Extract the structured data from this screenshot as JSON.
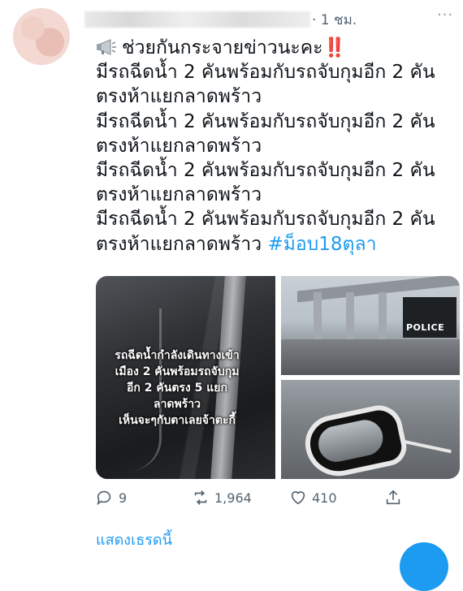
{
  "tweet": {
    "time": "· 1 ชม.",
    "more_label": "···",
    "lines": [
      "ช่วยกันกระจายข่าวนะคะ",
      "มีรถฉีดน้ำ 2 คันพร้อมกับรถจับกุมอีก 2 คัน",
      "ตรงห้าแยกลาดพร้าว",
      "มีรถฉีดน้ำ 2 คันพร้อมกับรถจับกุมอีก 2 คัน",
      "ตรงห้าแยกลาดพร้าว",
      "มีรถฉีดน้ำ 2 คันพร้อมกับรถจับกุมอีก 2 คัน",
      "ตรงห้าแยกลาดพร้าว",
      "มีรถฉีดน้ำ 2 คันพร้อมกับรถจับกุมอีก 2 คัน",
      "ตรงห้าแยกลาดพร้าว"
    ],
    "exclaim": "‼️",
    "hashtag": "#ม็อบ18ตุลา"
  },
  "media": {
    "overlay_lines": [
      "รถฉีดน้ำกำลังเดินทางเข้า",
      "เมือง 2 คันพร้อมรถจับกุม",
      "อีก 2 คันตรง 5 แยก",
      "ลาดพร้าว",
      "เห็นจะๆกับตาเลยจ้าตะกี้"
    ],
    "police_label": "POLICE"
  },
  "actions": {
    "replies": "9",
    "retweets": "1,964",
    "likes": "410"
  },
  "show_thread": "แสดงเธรดนี้",
  "colors": {
    "link": "#1d9bf0",
    "muted": "#536471",
    "accent_red": "#d41c1c"
  },
  "icons": [
    "megaphone-icon",
    "reply-icon",
    "retweet-icon",
    "like-icon",
    "share-icon",
    "more-icon"
  ]
}
